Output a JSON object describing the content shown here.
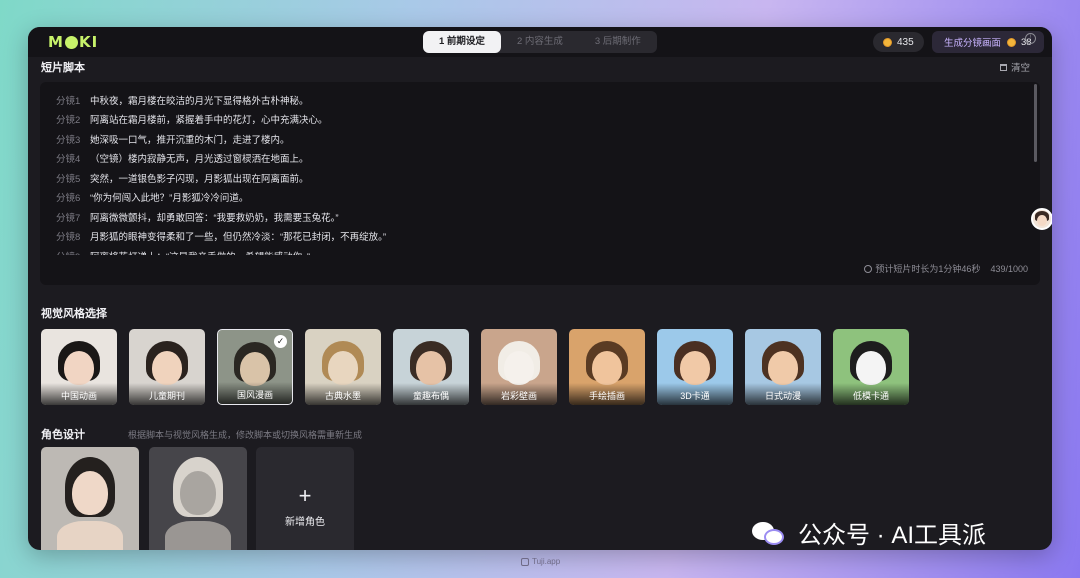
{
  "app": {
    "logo_text": "MOKI"
  },
  "steps": [
    {
      "label": "1 前期设定",
      "active": true
    },
    {
      "label": "2 内容生成",
      "active": false
    },
    {
      "label": "3 后期制作",
      "active": false
    }
  ],
  "header": {
    "coins": "435",
    "generate_label": "生成分镜画面",
    "generate_cost": "38"
  },
  "script": {
    "title": "短片脚本",
    "clear_label": "清空",
    "lines": [
      {
        "label": "分镜1",
        "text": "中秋夜，霜月楼在皎洁的月光下显得格外古朴神秘。"
      },
      {
        "label": "分镜2",
        "text": "阿离站在霜月楼前，紧握着手中的花灯，心中充满决心。"
      },
      {
        "label": "分镜3",
        "text": "她深吸一口气，推开沉重的木门，走进了楼内。"
      },
      {
        "label": "分镜4",
        "text": "（空镜）楼内寂静无声，月光透过窗棂洒在地面上。"
      },
      {
        "label": "分镜5",
        "text": "突然，一道银色影子闪现，月影狐出现在阿离面前。"
      },
      {
        "label": "分镜6",
        "text": "“你为何闯入此地？”月影狐冷冷问道。"
      },
      {
        "label": "分镜7",
        "text": "阿离微微颤抖，却勇敢回答：“我要救奶奶，我需要玉兔花。”"
      },
      {
        "label": "分镜8",
        "text": "月影狐的眼神变得柔和了一些，但仍然冷淡：“那花已封闭，不再绽放。”"
      },
      {
        "label": "分镜9",
        "text": "阿离将花灯递上：“这是我亲手做的，希望能感动你。”"
      }
    ],
    "duration": "预计短片时长为1分钟46秒",
    "char_count": "439/1000"
  },
  "styles": {
    "title": "视觉风格选择",
    "items": [
      {
        "label": "中国动画",
        "bg": "#e9e4df",
        "hair": "#1a1716",
        "skin": "#f1d5c3",
        "selected": false
      },
      {
        "label": "儿童期刊",
        "bg": "#d8d4cf",
        "hair": "#2a221e",
        "skin": "#f0d3bd",
        "selected": false
      },
      {
        "label": "国风漫画",
        "bg": "#8d9488",
        "hair": "#2a2722",
        "skin": "#d9c3a8",
        "selected": true
      },
      {
        "label": "古典水墨",
        "bg": "#d9d2c2",
        "hair": "#b08a55",
        "skin": "#e8d6bf",
        "selected": false
      },
      {
        "label": "童趣布偶",
        "bg": "#c7d3d8",
        "hair": "#3a2c24",
        "skin": "#e6c2a6",
        "selected": false
      },
      {
        "label": "岩彩壁画",
        "bg": "#c9a58c",
        "hair": "#f1ede6",
        "skin": "#f5f1ec",
        "selected": false
      },
      {
        "label": "手绘插画",
        "bg": "#d9a36b",
        "hair": "#5a3b23",
        "skin": "#f0c49c",
        "selected": false
      },
      {
        "label": "3D卡通",
        "bg": "#9cc9ea",
        "hair": "#4a2f22",
        "skin": "#f1c9a7",
        "selected": false
      },
      {
        "label": "日式动漫",
        "bg": "#a7c8e3",
        "hair": "#4d3222",
        "skin": "#f0caa9",
        "selected": false
      },
      {
        "label": "低模卡通",
        "bg": "#8ec27d",
        "hair": "#1d1d1d",
        "skin": "#f4f4f4",
        "selected": false
      }
    ]
  },
  "roles": {
    "title": "角色设计",
    "subtitle": "根据脚本与视觉风格生成，修改脚本或切换风格需重新生成",
    "add_label": "新增角色",
    "items": [
      {
        "bg": "#bdb9b4",
        "hair": "#24201e",
        "skin": "#efd8c8"
      },
      {
        "bg": "#46454a",
        "hair": "#d8d3cc",
        "skin": "#a9a5a0"
      }
    ]
  },
  "watermark": {
    "text": "公众号 · AI工具派"
  },
  "footer": {
    "tuji": "Tuji.app"
  }
}
